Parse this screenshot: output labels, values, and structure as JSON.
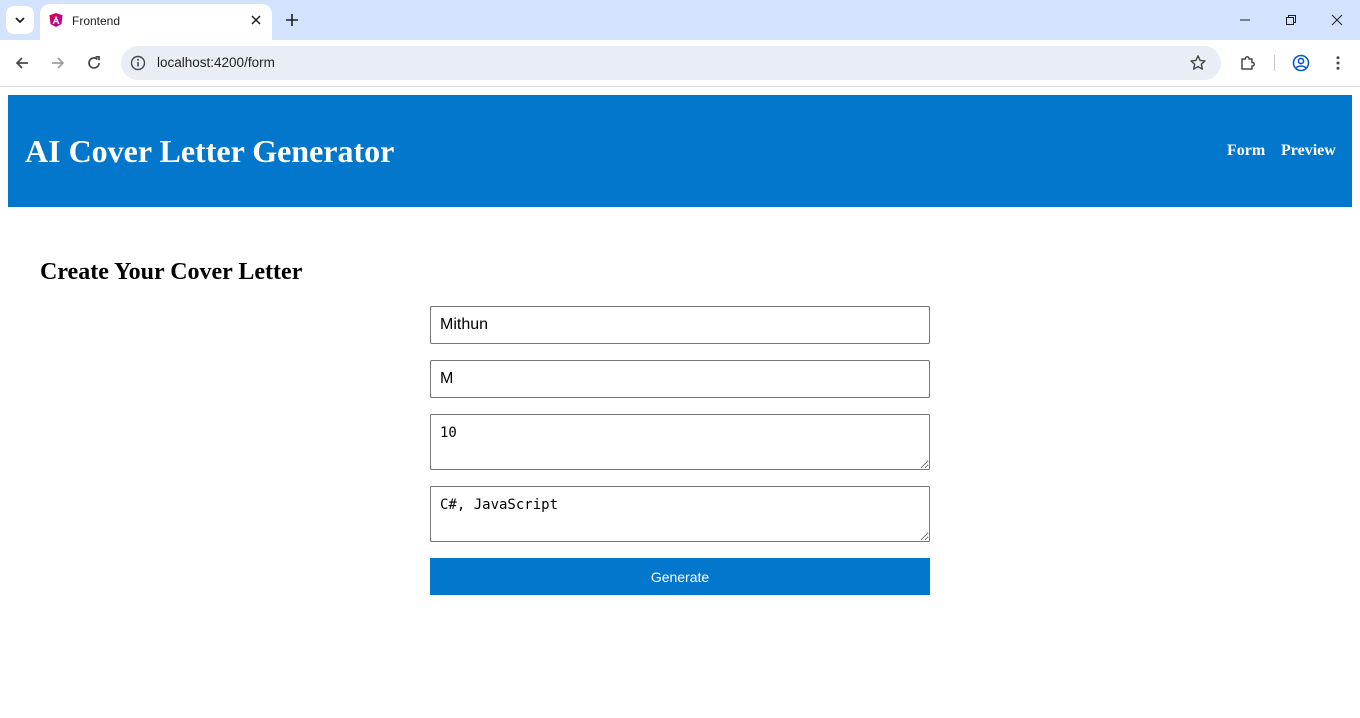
{
  "browser": {
    "tab_title": "Frontend",
    "url": "localhost:4200/form"
  },
  "icons": {
    "tab_search": "chevron-down-icon",
    "favicon": "angular-icon",
    "tab_close": "close-icon",
    "new_tab": "plus-icon",
    "back": "back-arrow-icon",
    "forward": "forward-arrow-icon",
    "reload": "reload-icon",
    "site_info": "info-icon",
    "bookmark": "star-icon",
    "extensions": "puzzle-icon",
    "profile": "profile-icon",
    "menu": "kebab-menu-icon"
  },
  "colors": {
    "brand": "#0277cc",
    "tabstrip": "#d3e3fd"
  },
  "header": {
    "title": "AI Cover Letter Generator",
    "nav": [
      "Form",
      "Preview"
    ]
  },
  "form": {
    "heading": "Create Your Cover Letter",
    "first_name": "Mithun",
    "last_name": "M",
    "experience": "10",
    "skills": "C#, JavaScript",
    "submit_label": "Generate"
  }
}
